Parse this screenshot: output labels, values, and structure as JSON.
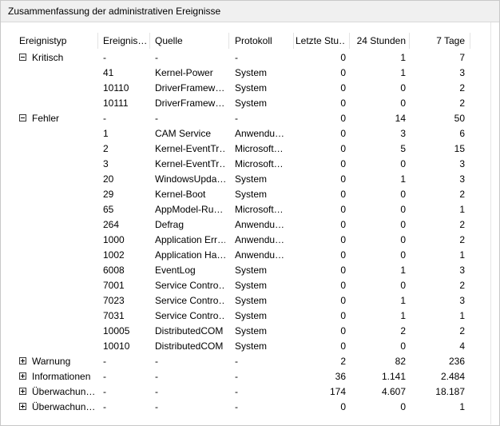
{
  "window": {
    "title": "Zusammenfassung der administrativen Ereignisse"
  },
  "columns": [
    "Ereignistyp",
    "Ereignis…",
    "Quelle",
    "Protokoll",
    "Letzte Stu…",
    "24 Stunden",
    "7 Tage"
  ],
  "groups": [
    {
      "type": "Kritisch",
      "expanded": true,
      "id": "-",
      "source": "-",
      "log": "-",
      "last_hour": "0",
      "h24": "1",
      "d7": "7",
      "rows": [
        {
          "id": "41",
          "source": "Kernel-Power",
          "log": "System",
          "last_hour": "0",
          "h24": "1",
          "d7": "3"
        },
        {
          "id": "10110",
          "source": "DriverFramew…",
          "log": "System",
          "last_hour": "0",
          "h24": "0",
          "d7": "2"
        },
        {
          "id": "10111",
          "source": "DriverFramew…",
          "log": "System",
          "last_hour": "0",
          "h24": "0",
          "d7": "2"
        }
      ]
    },
    {
      "type": "Fehler",
      "expanded": true,
      "id": "-",
      "source": "-",
      "log": "-",
      "last_hour": "0",
      "h24": "14",
      "d7": "50",
      "rows": [
        {
          "id": "1",
          "source": "CAM Service",
          "log": "Anwendu…",
          "last_hour": "0",
          "h24": "3",
          "d7": "6"
        },
        {
          "id": "2",
          "source": "Kernel-EventTr…",
          "log": "Microsoft…",
          "last_hour": "0",
          "h24": "5",
          "d7": "15"
        },
        {
          "id": "3",
          "source": "Kernel-EventTr…",
          "log": "Microsoft…",
          "last_hour": "0",
          "h24": "0",
          "d7": "3"
        },
        {
          "id": "20",
          "source": "WindowsUpda…",
          "log": "System",
          "last_hour": "0",
          "h24": "1",
          "d7": "3"
        },
        {
          "id": "29",
          "source": "Kernel-Boot",
          "log": "System",
          "last_hour": "0",
          "h24": "0",
          "d7": "2"
        },
        {
          "id": "65",
          "source": "AppModel-Ru…",
          "log": "Microsoft…",
          "last_hour": "0",
          "h24": "0",
          "d7": "1"
        },
        {
          "id": "264",
          "source": "Defrag",
          "log": "Anwendu…",
          "last_hour": "0",
          "h24": "0",
          "d7": "2"
        },
        {
          "id": "1000",
          "source": "Application Err…",
          "log": "Anwendu…",
          "last_hour": "0",
          "h24": "0",
          "d7": "2"
        },
        {
          "id": "1002",
          "source": "Application Ha…",
          "log": "Anwendu…",
          "last_hour": "0",
          "h24": "0",
          "d7": "1"
        },
        {
          "id": "6008",
          "source": "EventLog",
          "log": "System",
          "last_hour": "0",
          "h24": "1",
          "d7": "3"
        },
        {
          "id": "7001",
          "source": "Service Contro…",
          "log": "System",
          "last_hour": "0",
          "h24": "0",
          "d7": "2"
        },
        {
          "id": "7023",
          "source": "Service Contro…",
          "log": "System",
          "last_hour": "0",
          "h24": "1",
          "d7": "3"
        },
        {
          "id": "7031",
          "source": "Service Contro…",
          "log": "System",
          "last_hour": "0",
          "h24": "1",
          "d7": "1"
        },
        {
          "id": "10005",
          "source": "DistributedCOM",
          "log": "System",
          "last_hour": "0",
          "h24": "2",
          "d7": "2"
        },
        {
          "id": "10010",
          "source": "DistributedCOM",
          "log": "System",
          "last_hour": "0",
          "h24": "0",
          "d7": "4"
        }
      ]
    },
    {
      "type": "Warnung",
      "expanded": false,
      "id": "-",
      "source": "-",
      "log": "-",
      "last_hour": "2",
      "h24": "82",
      "d7": "236",
      "rows": []
    },
    {
      "type": "Informationen",
      "expanded": false,
      "id": "-",
      "source": "-",
      "log": "-",
      "last_hour": "36",
      "h24": "1.141",
      "d7": "2.484",
      "rows": []
    },
    {
      "type": "Überwachun…",
      "expanded": false,
      "id": "-",
      "source": "-",
      "log": "-",
      "last_hour": "174",
      "h24": "4.607",
      "d7": "18.187",
      "rows": []
    },
    {
      "type": "Überwachun…",
      "expanded": false,
      "id": "-",
      "source": "-",
      "log": "-",
      "last_hour": "0",
      "h24": "0",
      "d7": "1",
      "rows": []
    }
  ]
}
